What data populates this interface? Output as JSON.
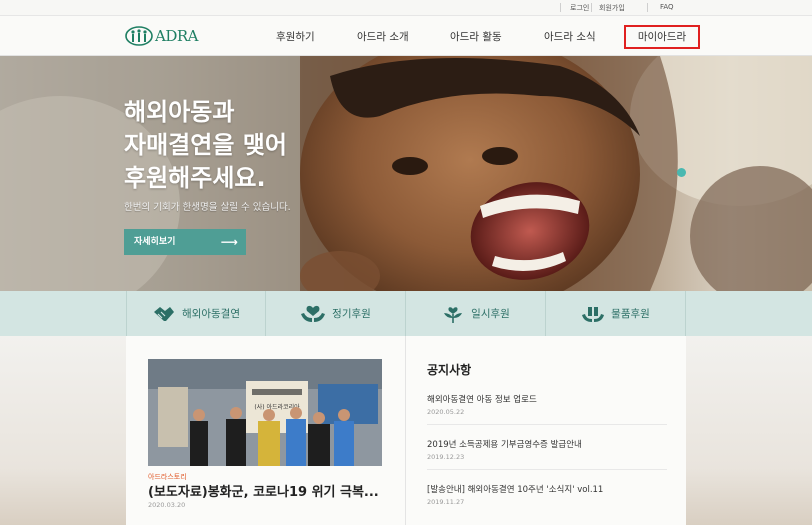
{
  "util": {
    "login": "로그인",
    "join": "회원가입",
    "faq": "FAQ"
  },
  "header": {
    "logo_text": "ADRA",
    "nav": [
      "후원하기",
      "아드라 소개",
      "아드라 활동",
      "아드라 소식"
    ],
    "mypage": "마이아드라"
  },
  "hero": {
    "headline": [
      "해외아동과",
      "자매결연을 맺어",
      "후원해주세요."
    ],
    "subtext": "한번의 기회가 한생명을 살릴 수 있습니다.",
    "button": "자세히보기",
    "button_arrow": "⟶"
  },
  "categories": [
    {
      "label": "해외아동결연",
      "icon": "handshake-icon"
    },
    {
      "label": "정기후원",
      "icon": "hands-heart-icon"
    },
    {
      "label": "일시후원",
      "icon": "plant-heart-icon"
    },
    {
      "label": "물품후원",
      "icon": "gift-hands-icon"
    }
  ],
  "news": {
    "photo_banner": "(사) 아드라코리아",
    "category": "아드라스토리",
    "title": "(보도자료)봉화군, 코로나19 위기 극복...",
    "date": "2020.03.20"
  },
  "notices": {
    "heading": "공지사항",
    "items": [
      {
        "title": "해외아동결연 아동 정보 업로드",
        "date": "2020.05.22"
      },
      {
        "title": "2019년 소득공제용 기부금영수증 발급안내",
        "date": "2019.12.23"
      },
      {
        "title": "[발송안내] 해외아동결연 10주년 '소식지' vol.11",
        "date": "2019.11.27"
      }
    ]
  },
  "colors": {
    "brand": "#1f7f63",
    "button": "#4f9e95",
    "catbar": "#d3e5e2",
    "highlight": "#e02020"
  }
}
